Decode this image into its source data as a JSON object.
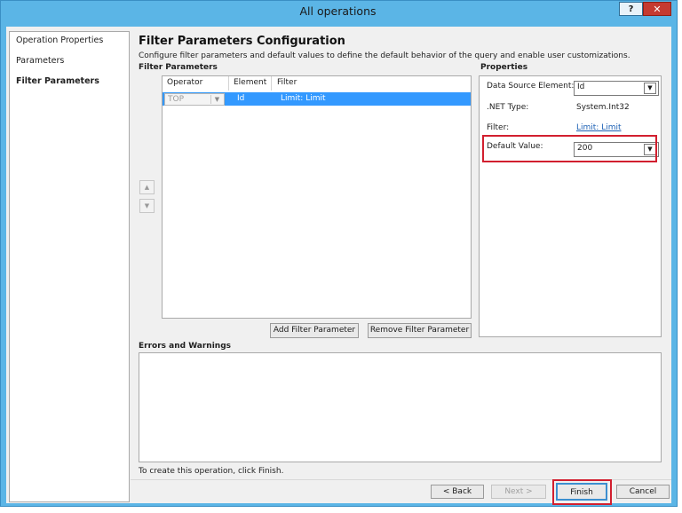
{
  "window": {
    "title": "All operations",
    "help_label": "?",
    "close_label": "✕"
  },
  "nav": {
    "items": [
      "Operation Properties",
      "Parameters",
      "Filter Parameters"
    ]
  },
  "main": {
    "heading": "Filter Parameters Configuration",
    "subtitle": "Configure filter parameters and default values to define the default behavior of the query and enable user customizations.",
    "filter_section": "Filter Parameters",
    "columns": [
      "Operator",
      "Element",
      "Filter"
    ],
    "row": {
      "operator": "TOP",
      "element": "Id",
      "filter": "Limit: Limit"
    },
    "add_button": "Add Filter Parameter",
    "remove_button": "Remove Filter Parameter",
    "errors_section": "Errors and Warnings",
    "footer_note": "To create this operation, click Finish."
  },
  "properties": {
    "section": "Properties",
    "data_source_label": "Data Source Element:",
    "data_source_value": "Id",
    "net_type_label": ".NET Type:",
    "net_type_value": "System.Int32",
    "filter_label": "Filter:",
    "filter_value": "Limit: Limit",
    "default_label": "Default Value:",
    "default_value": "200"
  },
  "buttons": {
    "back": "< Back",
    "next": "Next >",
    "finish": "Finish",
    "cancel": "Cancel"
  },
  "colors": {
    "titlebar": "#5bb5e6",
    "selection": "#3399ff",
    "highlight": "#d21f2f",
    "link": "#1a5fb4"
  }
}
